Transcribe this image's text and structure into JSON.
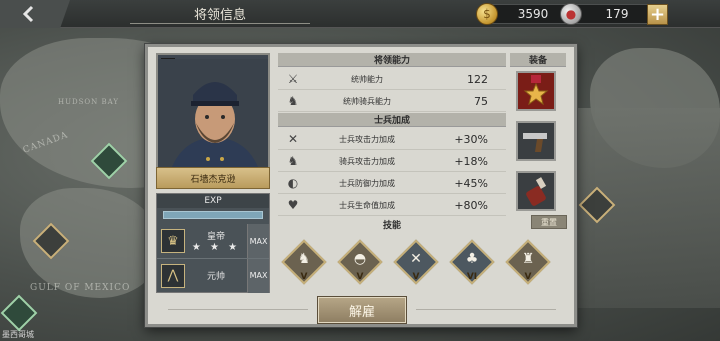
{
  "topbar": {
    "title": "将领信息",
    "gold": "3590",
    "silver": "179",
    "back_icon": "back-arrow-icon",
    "plus_label": "+"
  },
  "map": {
    "labels": [
      "GULF OF MEXICO",
      "CANADA",
      "HUDSON BAY"
    ],
    "bottom_left_text": "墨西哥城"
  },
  "general": {
    "name": "石墙杰克逊",
    "exp_label": "EXP",
    "exp_fraction": 1.0,
    "rank_title": "皇帝",
    "rank_stars": "★ ★ ★",
    "rank_max": "MAX",
    "military_title": "元帅",
    "military_max": "MAX"
  },
  "abilities": {
    "header": "将领能力",
    "items": [
      {
        "icon": "crossed-swords-icon",
        "label": "统帅能力",
        "value": "122"
      },
      {
        "icon": "horse-head-icon",
        "label": "统帅骑兵能力",
        "value": "75"
      }
    ]
  },
  "soldier_bonus": {
    "header": "士兵加成",
    "items": [
      {
        "icon": "attack-icon",
        "label": "士兵攻击力加成",
        "value": "+30%"
      },
      {
        "icon": "cavalry-icon",
        "label": "骑兵攻击力加成",
        "value": "+18%"
      },
      {
        "icon": "shield-icon",
        "label": "士兵防御力加成",
        "value": "+45%"
      },
      {
        "icon": "heart-icon",
        "label": "士兵生命值加成",
        "value": "+80%"
      }
    ]
  },
  "equipment": {
    "header": "装备",
    "items": [
      "medal-icon",
      "pistol-icon",
      "bottle-icon"
    ]
  },
  "skills": {
    "header": "技能",
    "reset_label": "重置",
    "items": [
      {
        "icon": "horse-icon",
        "level": "V",
        "color": "#6b6250"
      },
      {
        "icon": "helmet-icon",
        "level": "V",
        "color": "#6b6250"
      },
      {
        "icon": "crossed-rifles-icon",
        "level": "V",
        "color": "#4d5860"
      },
      {
        "icon": "pine-trees-icon",
        "level": "VI",
        "color": "#4d5860"
      },
      {
        "icon": "fortress-icon",
        "level": "V",
        "color": "#6b6250"
      }
    ]
  },
  "dismiss_label": "解雇",
  "colors": {
    "panel_bg": "#d9d8d1",
    "accent_gold": "#c6b07a",
    "exp_bar": "#7fa6b8"
  }
}
